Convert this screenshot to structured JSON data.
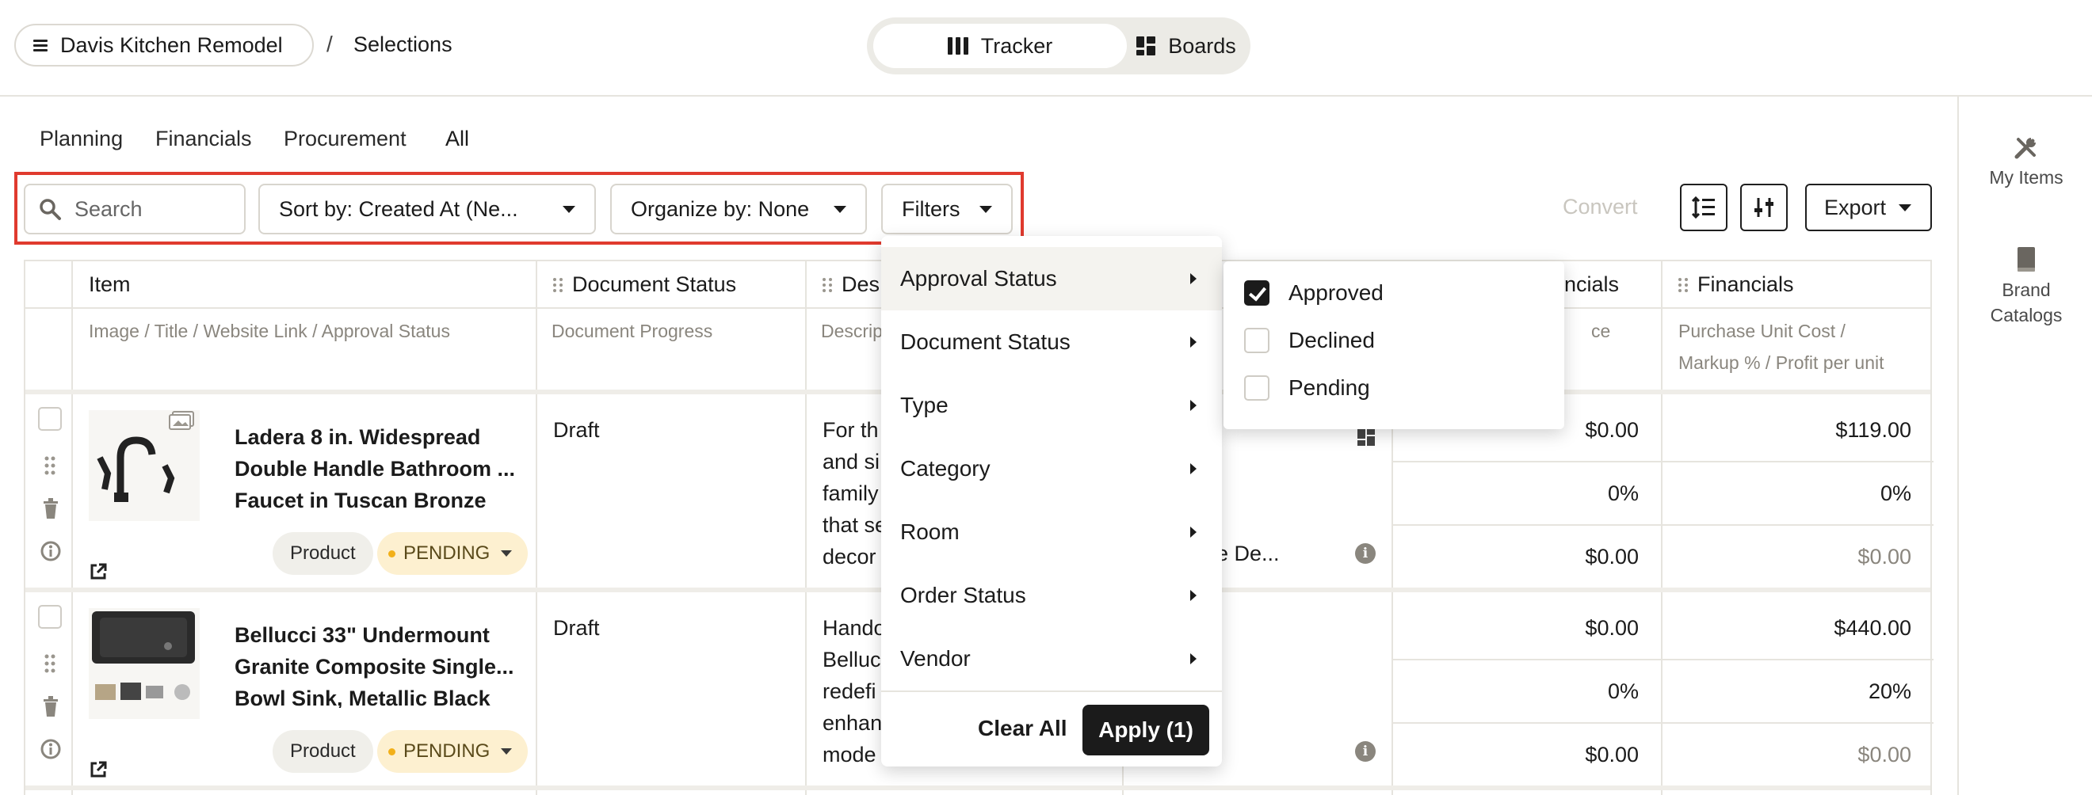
{
  "breadcrumb": {
    "project": "Davis Kitchen Remodel",
    "separator": "/",
    "current": "Selections"
  },
  "view_toggle": {
    "tracker": "Tracker",
    "boards": "Boards",
    "active": "Tracker"
  },
  "right_rail": {
    "my_items": "My Items",
    "brand_catalogs_line1": "Brand",
    "brand_catalogs_line2": "Catalogs"
  },
  "subtabs": {
    "planning": "Planning",
    "financials": "Financials",
    "procurement": "Procurement",
    "all": "All",
    "active": "All"
  },
  "controls": {
    "search_placeholder": "Search",
    "sort": "Sort by: Created At (Ne...",
    "organize": "Organize by: None",
    "filters": "Filters",
    "convert": "Convert",
    "export": "Export"
  },
  "table": {
    "headers": {
      "item": "Item",
      "document_status": "Document Status",
      "description": "Des",
      "financials_partial": "ncials",
      "financials": "Financials"
    },
    "subheaders": {
      "item": "Image / Title / Website Link / Approval Status",
      "document": "Document Progress",
      "description": "Descrip",
      "financials_partial": "ce",
      "financials_line1": "Purchase Unit Cost /",
      "financials_line2": "Markup % / Profit per unit"
    },
    "rows": [
      {
        "title": "Ladera 8 in. Widespread Double Handle Bathroom ... Faucet in Tuscan Bronze",
        "type": "Product",
        "status": "PENDING",
        "document_status": "Draft",
        "description_lines": [
          "For th",
          "and si",
          "family",
          "that se",
          "decor"
        ],
        "vendor_partial": "ne De...",
        "col_a": [
          "$0.00",
          "0%",
          "$0.00"
        ],
        "col_b": [
          "$119.00",
          "0%",
          "$0.00"
        ]
      },
      {
        "title": "Bellucci 33\" Undermount Granite Composite Single... Bowl Sink, Metallic Black",
        "type": "Product",
        "status": "PENDING",
        "document_status": "Draft",
        "description_lines": [
          "Hando",
          "Belluc",
          "redefi",
          "enhan",
          "mode"
        ],
        "vendor_partial": "",
        "col_a": [
          "$0.00",
          "0%",
          "$0.00"
        ],
        "col_b": [
          "$440.00",
          "20%",
          "$0.00"
        ]
      }
    ]
  },
  "filter_menu": {
    "items": [
      "Approval Status",
      "Document Status",
      "Type",
      "Category",
      "Room",
      "Order Status",
      "Vendor"
    ],
    "active": "Approval Status",
    "clear_all": "Clear All",
    "apply": "Apply (1)"
  },
  "approval_submenu": [
    {
      "label": "Approved",
      "checked": true
    },
    {
      "label": "Declined",
      "checked": false
    },
    {
      "label": "Pending",
      "checked": false
    }
  ],
  "colors": {
    "highlight": "#e03a2e",
    "pending_bg": "#fdf0d0",
    "pending_dot": "#f2b019",
    "apply_bg": "#1b1b1b"
  }
}
